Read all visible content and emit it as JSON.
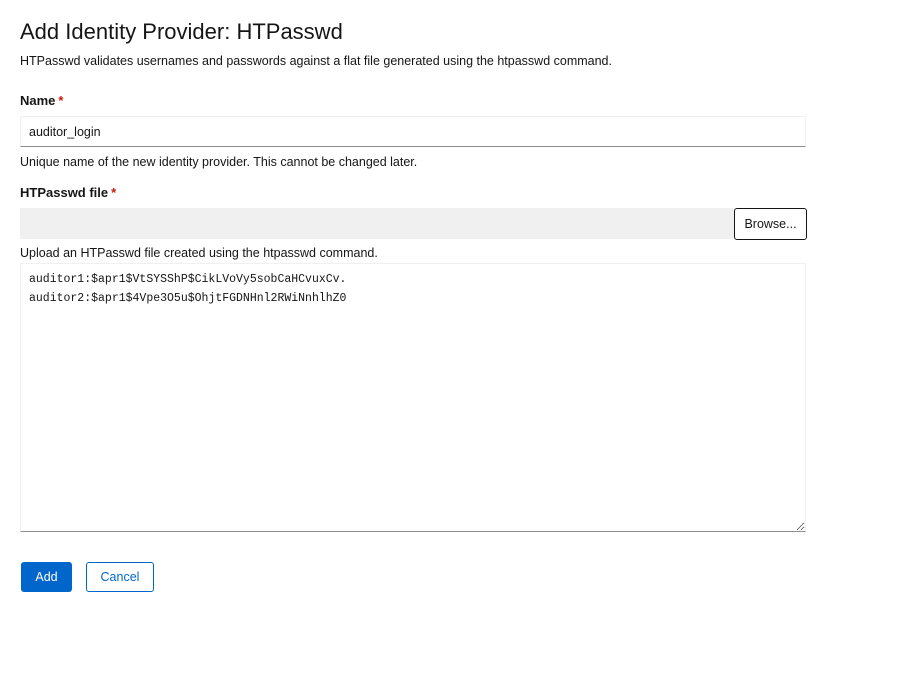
{
  "page": {
    "title": "Add Identity Provider: HTPasswd",
    "description": "HTPasswd validates usernames and passwords against a flat file generated using the htpasswd command."
  },
  "form": {
    "name": {
      "label": "Name",
      "required_marker": "*",
      "value": "auditor_login",
      "helper": "Unique name of the new identity provider. This cannot be changed later."
    },
    "htpasswd_file": {
      "label": "HTPasswd file",
      "required_marker": "*",
      "filename": "",
      "browse_label": "Browse...",
      "helper": "Upload an HTPasswd file created using the htpasswd command.",
      "contents": "auditor1:$apr1$VtSYSShP$CikLVoVy5sobCaHCvuxCv.\nauditor2:$apr1$4Vpe3O5u$OhjtFGDNHnl2RWiNnhlhZ0"
    }
  },
  "actions": {
    "add_label": "Add",
    "cancel_label": "Cancel"
  },
  "colors": {
    "primary": "#0066cc",
    "required": "#c9190b",
    "text": "#151515"
  }
}
